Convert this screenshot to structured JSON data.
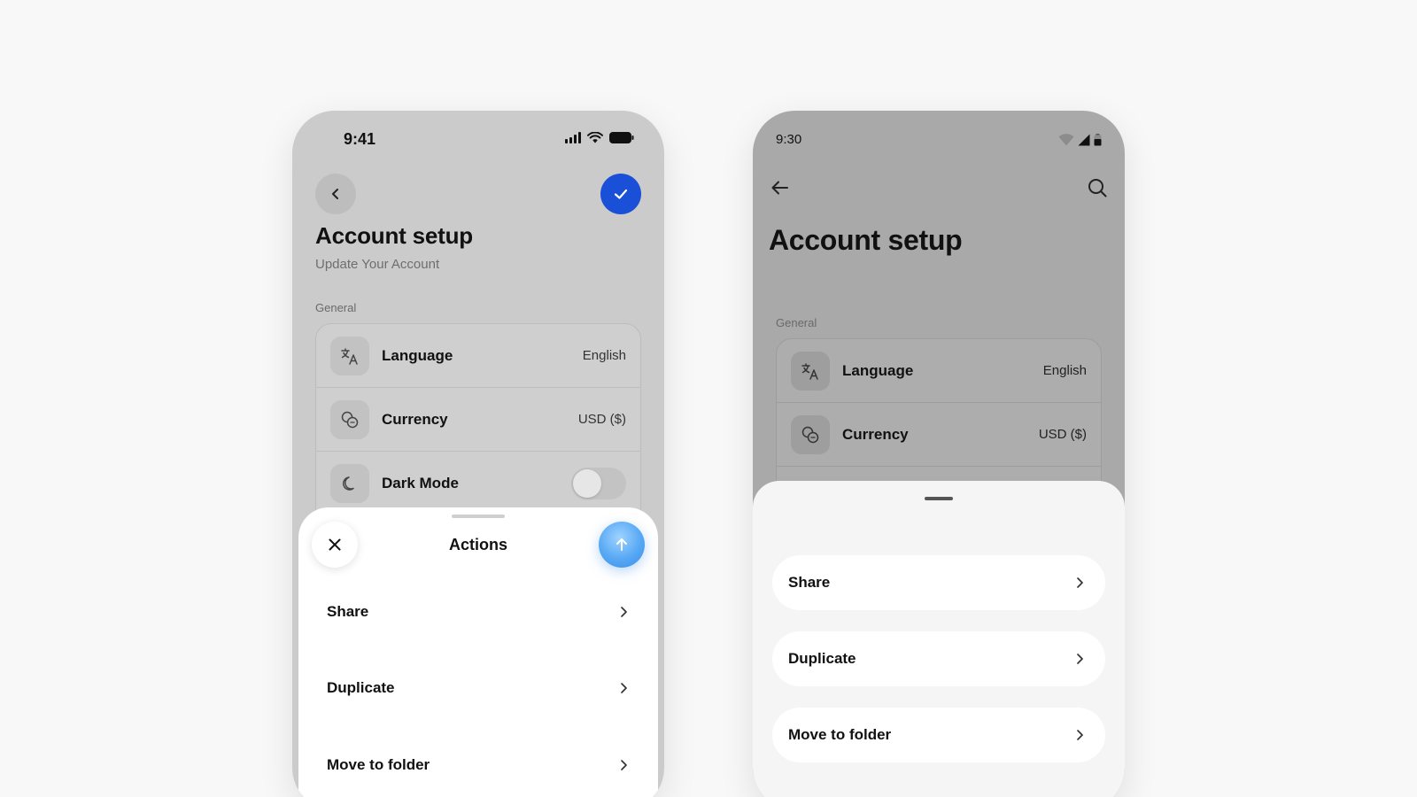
{
  "ios": {
    "status_time": "9:41",
    "title": "Account setup",
    "subtitle": "Update Your Account",
    "section_label": "General",
    "settings": [
      {
        "label": "Language",
        "value": "English",
        "icon": "translate-icon"
      },
      {
        "label": "Currency",
        "value": "USD ($)",
        "icon": "coins-icon"
      },
      {
        "label": "Dark Mode",
        "icon": "moon-icon",
        "toggle_on": false
      }
    ],
    "sheet": {
      "title": "Actions",
      "items": [
        {
          "label": "Share"
        },
        {
          "label": "Duplicate"
        },
        {
          "label": "Move to folder"
        }
      ]
    },
    "colors": {
      "accent": "#1a4fd8",
      "send_button": "#57a8f4"
    }
  },
  "android": {
    "status_time": "9:30",
    "title": "Account setup",
    "section_label": "General",
    "settings": [
      {
        "label": "Language",
        "value": "English",
        "icon": "translate-icon"
      },
      {
        "label": "Currency",
        "value": "USD ($)",
        "icon": "coins-icon"
      }
    ],
    "sheet": {
      "items": [
        {
          "label": "Share"
        },
        {
          "label": "Duplicate"
        },
        {
          "label": "Move to folder"
        }
      ]
    }
  }
}
